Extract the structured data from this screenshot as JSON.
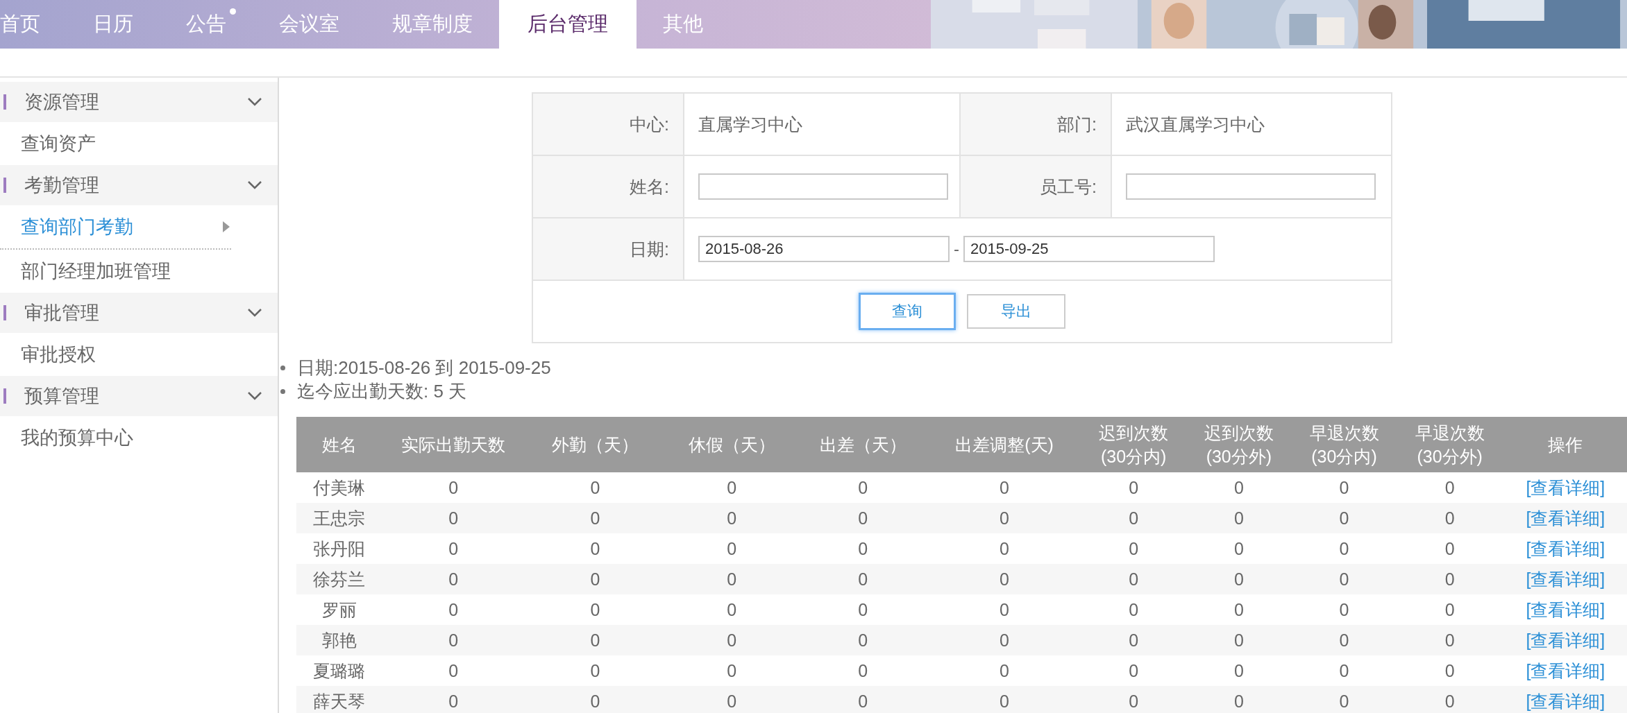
{
  "nav": {
    "tabs": [
      {
        "label": "首页",
        "selected": false,
        "dot": false
      },
      {
        "label": "日历",
        "selected": false,
        "dot": false
      },
      {
        "label": "公告",
        "selected": false,
        "dot": true
      },
      {
        "label": "会议室",
        "selected": false,
        "dot": false
      },
      {
        "label": "规章制度",
        "selected": false,
        "dot": false
      },
      {
        "label": "后台管理",
        "selected": true,
        "dot": false
      },
      {
        "label": "其他",
        "selected": false,
        "dot": false
      }
    ]
  },
  "sidebar": {
    "groups": [
      {
        "title": "资源管理",
        "expanded": true,
        "items": [
          {
            "label": "查询资产",
            "selected": false
          }
        ]
      },
      {
        "title": "考勤管理",
        "expanded": true,
        "items": [
          {
            "label": "查询部门考勤",
            "selected": true
          },
          {
            "label": "部门经理加班管理",
            "selected": false
          }
        ]
      },
      {
        "title": "审批管理",
        "expanded": true,
        "items": [
          {
            "label": "审批授权",
            "selected": false
          }
        ]
      },
      {
        "title": "预算管理",
        "expanded": true,
        "items": [
          {
            "label": "我的预算中心",
            "selected": false
          }
        ]
      }
    ]
  },
  "form": {
    "center_label": "中心:",
    "center_value": "直属学习中心",
    "dept_label": "部门:",
    "dept_value": "武汉直属学习中心",
    "name_label": "姓名:",
    "staff_label": "员工号:",
    "date_label": "日期:",
    "date_from": "2015-08-26",
    "date_sep": "-",
    "date_to": "2015-09-25",
    "buttons": [
      {
        "label": "查询",
        "focused": true
      },
      {
        "label": "导出",
        "focused": false
      }
    ]
  },
  "summary": [
    "日期:2015-08-26 到 2015-09-25",
    "迄今应出勤天数: 5 天"
  ],
  "table": {
    "columns": [
      "姓名",
      "实际出勤天数",
      "外勤（天）",
      "休假（天）",
      "出差（天）",
      "出差调整(天)",
      "迟到次数\n(30分内)",
      "迟到次数\n(30分外)",
      "早退次数\n(30分内)",
      "早退次数\n(30分外)",
      "操作"
    ],
    "rows": [
      [
        "付美琳",
        "0",
        "0",
        "0",
        "0",
        "0",
        "0",
        "0",
        "0",
        "0",
        "[查看详细]"
      ],
      [
        "王忠宗",
        "0",
        "0",
        "0",
        "0",
        "0",
        "0",
        "0",
        "0",
        "0",
        "[查看详细]"
      ],
      [
        "张丹阳",
        "0",
        "0",
        "0",
        "0",
        "0",
        "0",
        "0",
        "0",
        "0",
        "[查看详细]"
      ],
      [
        "徐芬兰",
        "0",
        "0",
        "0",
        "0",
        "0",
        "0",
        "0",
        "0",
        "0",
        "[查看详细]"
      ],
      [
        "罗丽",
        "0",
        "0",
        "0",
        "0",
        "0",
        "0",
        "0",
        "0",
        "0",
        "[查看详细]"
      ],
      [
        "郭艳",
        "0",
        "0",
        "0",
        "0",
        "0",
        "0",
        "0",
        "0",
        "0",
        "[查看详细]"
      ],
      [
        "夏璐璐",
        "0",
        "0",
        "0",
        "0",
        "0",
        "0",
        "0",
        "0",
        "0",
        "[查看详细]"
      ],
      [
        "薛天琴",
        "0",
        "0",
        "0",
        "0",
        "0",
        "0",
        "0",
        "0",
        "0",
        "[查看详细]"
      ]
    ]
  }
}
